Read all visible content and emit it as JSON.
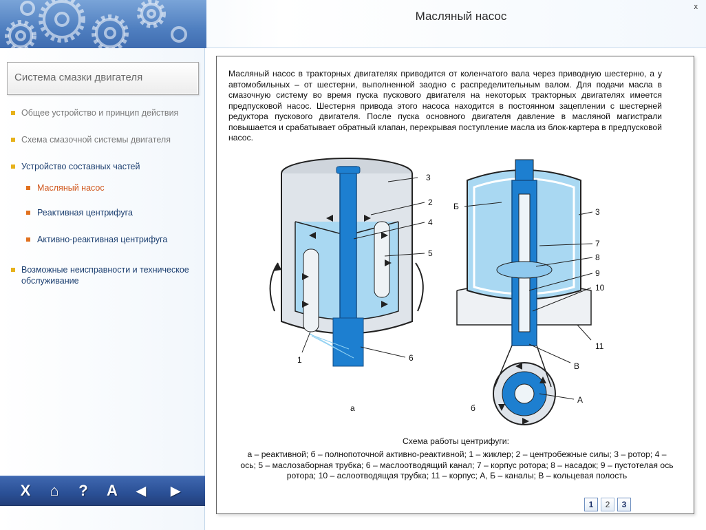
{
  "window": {
    "title": "Масляный насос",
    "close_label": "x"
  },
  "sidebar": {
    "section_title": "Система смазки двигателя",
    "items": [
      {
        "label": "Общее устройство и принцип действия"
      },
      {
        "label": "Схема смазочной системы двигателя"
      },
      {
        "label": "Устройство составных частей"
      },
      {
        "label": "Масляный насос"
      },
      {
        "label": "Реактивная центрифуга"
      },
      {
        "label": "Активно-реактивная центрифуга"
      },
      {
        "label": "Возможные неисправности и техническое обслуживание"
      }
    ]
  },
  "toolbar": {
    "buttons": [
      {
        "label": "X",
        "icon": "exit-icon"
      },
      {
        "label": "⌂",
        "icon": "home-icon"
      },
      {
        "label": "?",
        "icon": "help-icon"
      },
      {
        "label": "A",
        "icon": "glossary-icon"
      },
      {
        "label": "◀",
        "icon": "back-arrow-icon"
      },
      {
        "label": "▶",
        "icon": "forward-arrow-icon"
      }
    ]
  },
  "content": {
    "description": "Масляный насос в тракторных двигателях приводится от коленчатого вала через приводную шестерню, а у автомобильных – от шестерни, выполненной заодно с распределительным валом. Для подачи масла в смазочную систему во время пуска пускового двигателя на некоторых тракторных двигателях имеется предпусковой насос. Шестерня привода этого насоса находится в постоянном зацеплении с шестерней редуктора пускового двигателя. После пуска основного двигателя давление в масляной магистрали повышается и срабатывает обратный клапан, перекрывая поступление масла из блок-картера в предпусковой насос.",
    "figure": {
      "left_labels": [
        "3",
        "2",
        "4",
        "5",
        "1",
        "6",
        "а"
      ],
      "right_labels": [
        "Б",
        "3",
        "7",
        "8",
        "9",
        "10",
        "11",
        "В",
        "А",
        "б"
      ]
    },
    "caption_title": "Схема работы центрифуги:",
    "caption_text": "а – реактивной; б – полнопоточной активно-реактивной; 1 – жиклер; 2 – центробежные силы; 3 – ротор; 4 – ось; 5 – маслозаборная трубка; 6 – маслоотводящий канал; 7 – корпус ротора; 8 – насадок; 9 – пустотелая ось ротора; 10 – аслоотводящая трубка; 11 – корпус; А, Б – каналы; В – кольцевая полость"
  },
  "pager": {
    "pages": [
      "1",
      "2",
      "3"
    ],
    "current": "1"
  },
  "colors": {
    "header_blue": "#4f7fc0",
    "nav_bullet": "#e7b11b",
    "active_item": "#d0571d",
    "toolbar_blue": "#2a4f95",
    "oil_blue": "#1d7fd0"
  }
}
